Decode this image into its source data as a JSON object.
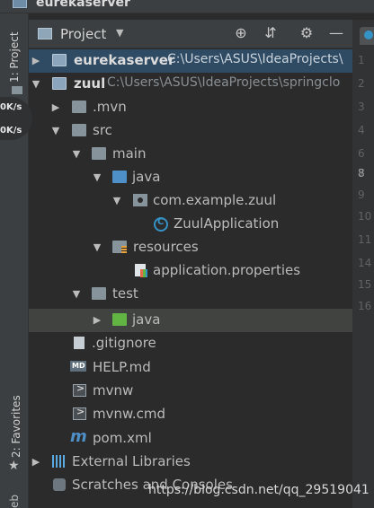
{
  "window": {
    "title": "eurekaserver"
  },
  "left_strip": {
    "project_tab": "1: Project",
    "favorites_tab": "2: Favorites",
    "web_tab": "eb",
    "speed_up": "0K/s",
    "speed_down": "0K/s"
  },
  "panel": {
    "title": "Project",
    "caret": "▼",
    "tools": {
      "locate": "⊕",
      "collapse": "⇵",
      "settings": "⚙",
      "hide": "—"
    }
  },
  "tree": [
    {
      "name": "eurekaserver",
      "path": "C:\\Users\\ASUS\\IdeaProjects\\",
      "bold": true
    },
    {
      "name": "zuul",
      "path": "C:\\Users\\ASUS\\IdeaProjects\\springclo",
      "bold": true
    },
    {
      "name": ".mvn"
    },
    {
      "name": "src"
    },
    {
      "name": "main"
    },
    {
      "name": "java"
    },
    {
      "name": "com.example.zuul"
    },
    {
      "name": "ZuulApplication"
    },
    {
      "name": "resources"
    },
    {
      "name": "application.properties"
    },
    {
      "name": "test"
    },
    {
      "name": "java"
    },
    {
      "name": ".gitignore"
    },
    {
      "name": "HELP.md"
    },
    {
      "name": "mvnw"
    },
    {
      "name": "mvnw.cmd"
    },
    {
      "name": "pom.xml"
    },
    {
      "name": "External Libraries"
    },
    {
      "name": "Scratches and Consoles"
    }
  ],
  "line_numbers": [
    "1",
    "2",
    "3",
    "4",
    "6",
    "7",
    "8",
    "9",
    "10",
    "11",
    "14",
    "15",
    "16"
  ],
  "watermark": "https://blog.csdn.net/qq_29519041",
  "colors": {
    "selection": "#2f4a63",
    "hover": "#414341",
    "accent": "#3592c4"
  }
}
